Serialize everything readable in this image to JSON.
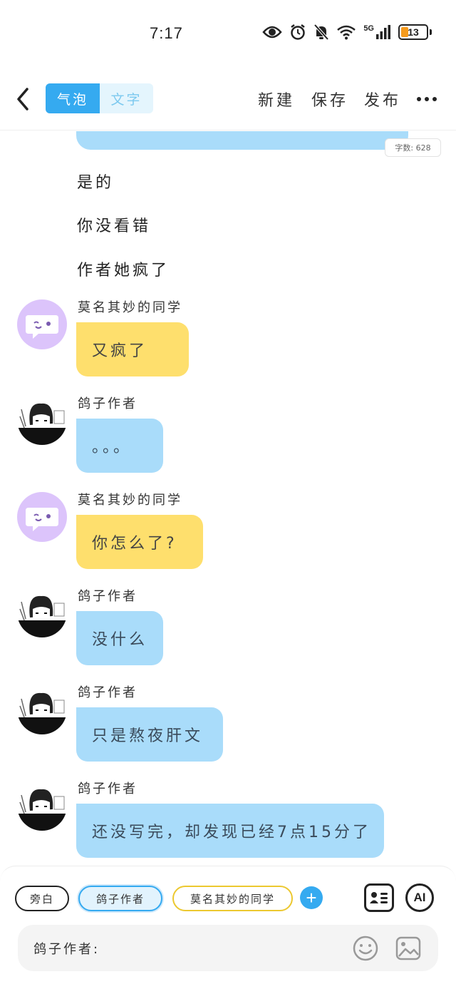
{
  "status_bar": {
    "time": "7:17",
    "battery": "13",
    "network": "5G",
    "icons": [
      "eye-icon",
      "alarm-icon",
      "bell-muted-icon",
      "wifi-icon",
      "signal-icon",
      "battery-icon"
    ]
  },
  "header": {
    "tab_bubble": "气泡",
    "tab_text": "文字",
    "new_label": "新建",
    "save_label": "保存",
    "publish_label": "发布"
  },
  "word_count": "字数: 628",
  "narration": [
    "是的",
    "你没看错",
    "作者她疯了"
  ],
  "messages": [
    {
      "speaker": "莫名其妙的同学",
      "text": "又疯了",
      "color": "yellow"
    },
    {
      "speaker": "鸽子作者",
      "text": "。。。",
      "color": "blue"
    },
    {
      "speaker": "莫名其妙的同学",
      "text": "你怎么了?",
      "color": "yellow"
    },
    {
      "speaker": "鸽子作者",
      "text": "没什么",
      "color": "blue"
    },
    {
      "speaker": "鸽子作者",
      "text": "只是熬夜肝文",
      "color": "blue"
    },
    {
      "speaker": "鸽子作者",
      "text": "还没写完，却发现已经7点15分了",
      "color": "blue"
    }
  ],
  "roles": {
    "narrator": "旁白",
    "author": "鸽子作者",
    "classmate": "莫名其妙的同学"
  },
  "input": {
    "prefix": "鸽子作者:"
  },
  "ai_label": "AI",
  "colors": {
    "accent": "#35aaf0",
    "bubble_blue": "#a9dcfa",
    "bubble_yellow": "#fedf6d",
    "avatar_purple": "#dcc4fb"
  }
}
